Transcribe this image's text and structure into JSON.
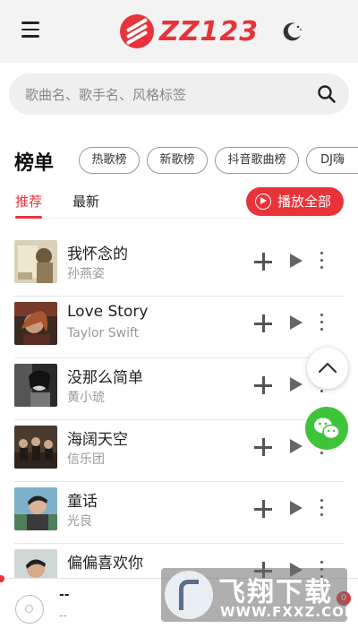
{
  "header": {
    "logo_text": "ZZ123",
    "menu_icon": "menu-icon",
    "theme_icon": "moon-icon"
  },
  "search": {
    "placeholder": "歌曲名、歌手名、风格标签",
    "icon": "search-icon"
  },
  "board": {
    "title": "榜单",
    "chips": [
      "热歌榜",
      "新歌榜",
      "抖音歌曲榜",
      "DJ嗨"
    ]
  },
  "tabs": {
    "items": [
      "推荐",
      "最新"
    ],
    "active": "推荐",
    "play_all": "播放全部"
  },
  "songs": [
    {
      "title": "我怀念的",
      "artist": "孙燕姿"
    },
    {
      "title": "Love Story",
      "artist": "Taylor Swift"
    },
    {
      "title": "没那么简单",
      "artist": "黄小琥"
    },
    {
      "title": "海阔天空",
      "artist": "信乐团"
    },
    {
      "title": "童话",
      "artist": "光良"
    },
    {
      "title": "偏偏喜欢你",
      "artist": ""
    }
  ],
  "player": {
    "title": "--",
    "subtitle": "--",
    "badge": "0"
  },
  "watermark": {
    "title": "飞翔下载",
    "url": "WWW.FXXZ.COM"
  },
  "colors": {
    "accent": "#e8333a",
    "wechat": "#3ec43a"
  }
}
